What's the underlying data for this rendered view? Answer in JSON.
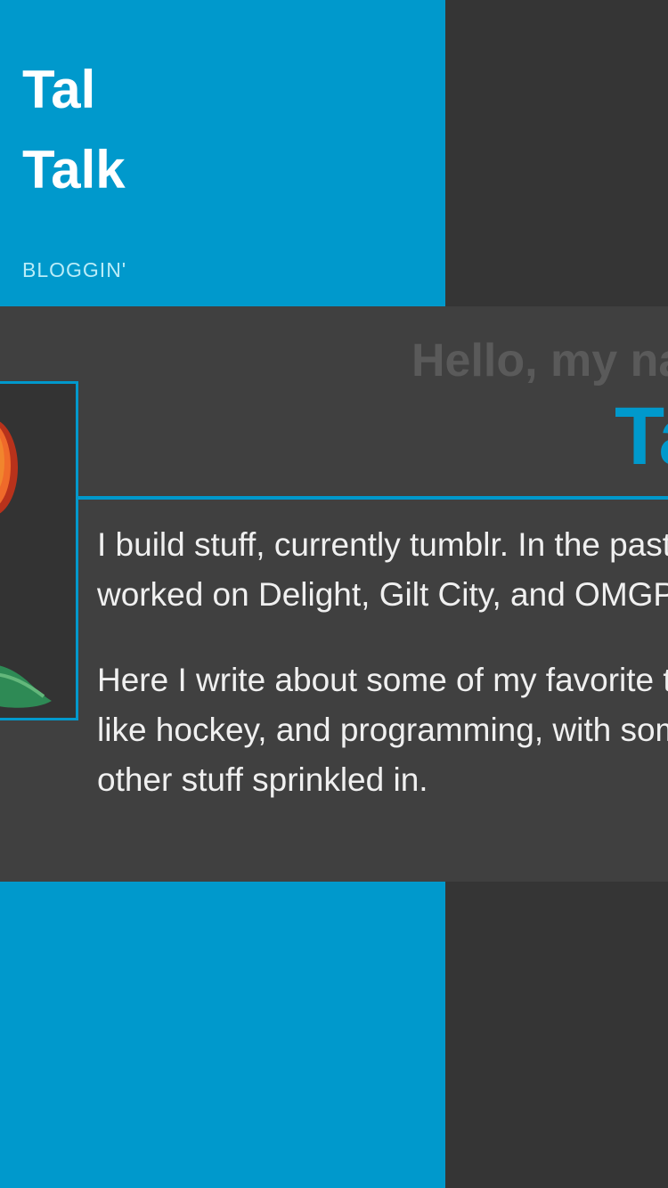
{
  "sidebar": {
    "title": "Tal Talk",
    "nav_items": [
      {
        "label": "Bloggin'"
      }
    ],
    "background_color": "#0099cc",
    "title_color": "#ffffff",
    "nav_color": "#b9ecf8"
  },
  "about": {
    "greeting": "Hello, my name is",
    "name": "Tal",
    "bio_paragraphs": [
      "I build stuff, currently tumblr. In the past I worked on Delight, Gilt City, and OMGPOP.",
      "Here I write about some of my favorite things, like hockey, and programming, with some other stuff sprinkled in."
    ],
    "avatar_icon": "avatar-photo",
    "accent_color": "#0099cc",
    "greeting_color": "#5a5a5a",
    "text_color": "#f0f0f0",
    "panel_color": "#404040"
  },
  "page": {
    "background_color": "#353535"
  }
}
